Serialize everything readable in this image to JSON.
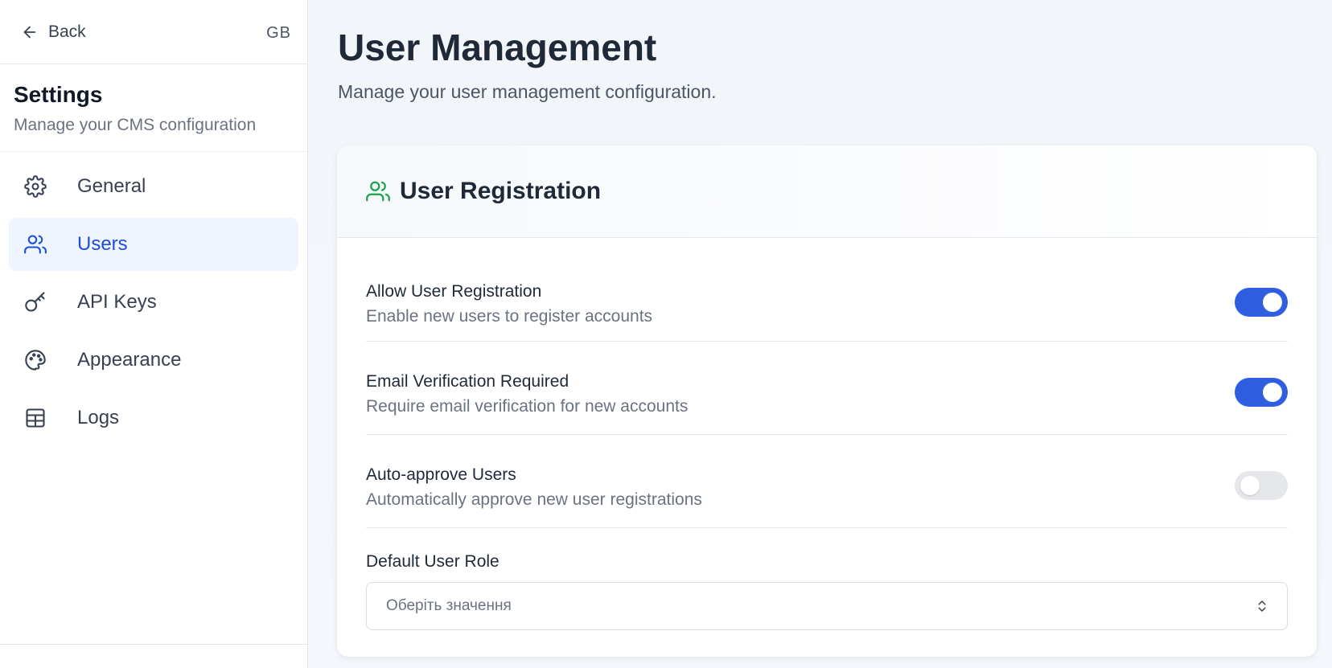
{
  "sidebar": {
    "back_label": "Back",
    "lang_code": "GB",
    "title": "Settings",
    "subtitle": "Manage your CMS configuration",
    "items": [
      {
        "label": "General",
        "icon": "gear-icon",
        "active": false
      },
      {
        "label": "Users",
        "icon": "users-icon",
        "active": true
      },
      {
        "label": "API Keys",
        "icon": "key-icon",
        "active": false
      },
      {
        "label": "Appearance",
        "icon": "palette-icon",
        "active": false
      },
      {
        "label": "Logs",
        "icon": "table-icon",
        "active": false
      }
    ]
  },
  "main": {
    "title": "User Management",
    "subtitle": "Manage your user management configuration.",
    "card": {
      "title": "User Registration",
      "icon": "users-icon",
      "icon_color": "#16a34a",
      "settings": [
        {
          "label": "Allow User Registration",
          "description": "Enable new users to register accounts",
          "enabled": true
        },
        {
          "label": "Email Verification Required",
          "description": "Require email verification for new accounts",
          "enabled": true
        },
        {
          "label": "Auto-approve Users",
          "description": "Automatically approve new user registrations",
          "enabled": false
        }
      ],
      "default_role": {
        "label": "Default User Role",
        "placeholder": "Оберіть значення"
      }
    }
  },
  "colors": {
    "accent": "#2f5fe0",
    "active_nav_bg": "#eef5ff",
    "active_nav_text": "#1d4ed8"
  }
}
